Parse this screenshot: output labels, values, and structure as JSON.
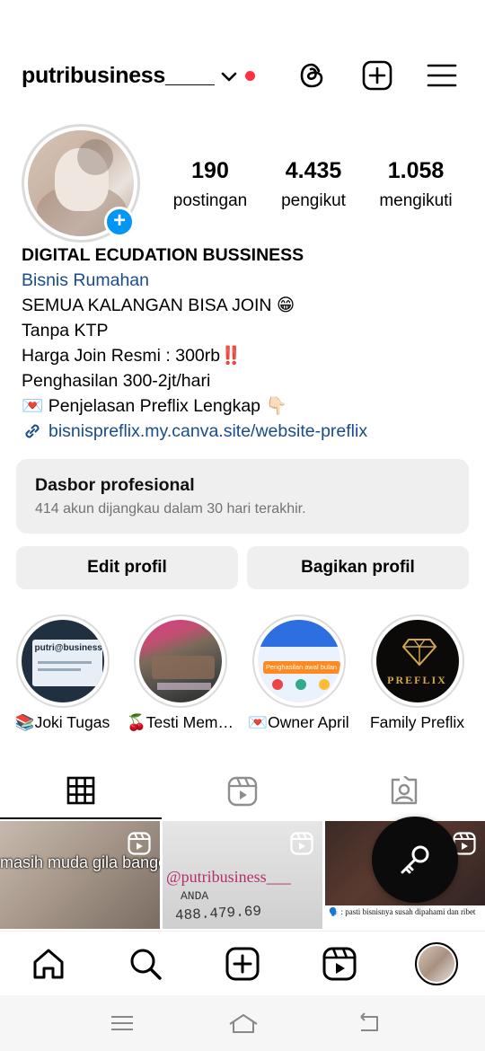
{
  "header": {
    "username": "putribusiness____",
    "icons": [
      "chevron-down-icon",
      "threads-icon",
      "create-post-icon",
      "menu-icon"
    ]
  },
  "profile": {
    "stats": [
      {
        "value": "190",
        "label": "postingan"
      },
      {
        "value": "4.435",
        "label": "pengikut"
      },
      {
        "value": "1.058",
        "label": "mengikuti"
      }
    ],
    "add_story_symbol": "+"
  },
  "bio": {
    "name": "DIGITAL ECUDATION BUSSINESS",
    "category": "Bisnis Rumahan",
    "lines": [
      "SEMUA KALANGAN BISA JOIN 😁",
      "Tanpa KTP",
      "Harga Join Resmi : 300rb‼️",
      "Penghasilan 300-2jt/hari",
      "💌 Penjelasan Preflix Lengkap 👇🏻"
    ],
    "link": "bisnispreflix.my.canva.site/website-preflix"
  },
  "dashboard": {
    "title": "Dasbor profesional",
    "subtitle": "414 akun dijangkau dalam 30 hari terakhir."
  },
  "buttons": {
    "edit": "Edit profil",
    "share": "Bagikan profil"
  },
  "highlights": [
    {
      "label": "📚Joki Tugas",
      "thumb_text": "putri@business"
    },
    {
      "label": "🍒Testi Mem…",
      "thumb_text": ""
    },
    {
      "label": "💌Owner April",
      "thumb_text": "Penghasilan awal bulan"
    },
    {
      "label": "Family Preflix",
      "thumb_text": "PREFLIX"
    }
  ],
  "posts": [
    {
      "caption": "masih muda gila banget bisnis, sutt nak manja ngga di aja"
    },
    {
      "caption": "@putribusiness___",
      "sub": "ANDA",
      "number": "488.479.69"
    },
    {
      "caption": "🗣️ : pasti bisnisnya susah dipahami dan ribet"
    }
  ],
  "colors": {
    "accent": "#0095f6",
    "link": "#1a4b8c",
    "notification": "#ff3040",
    "button_bg": "#efefef"
  }
}
